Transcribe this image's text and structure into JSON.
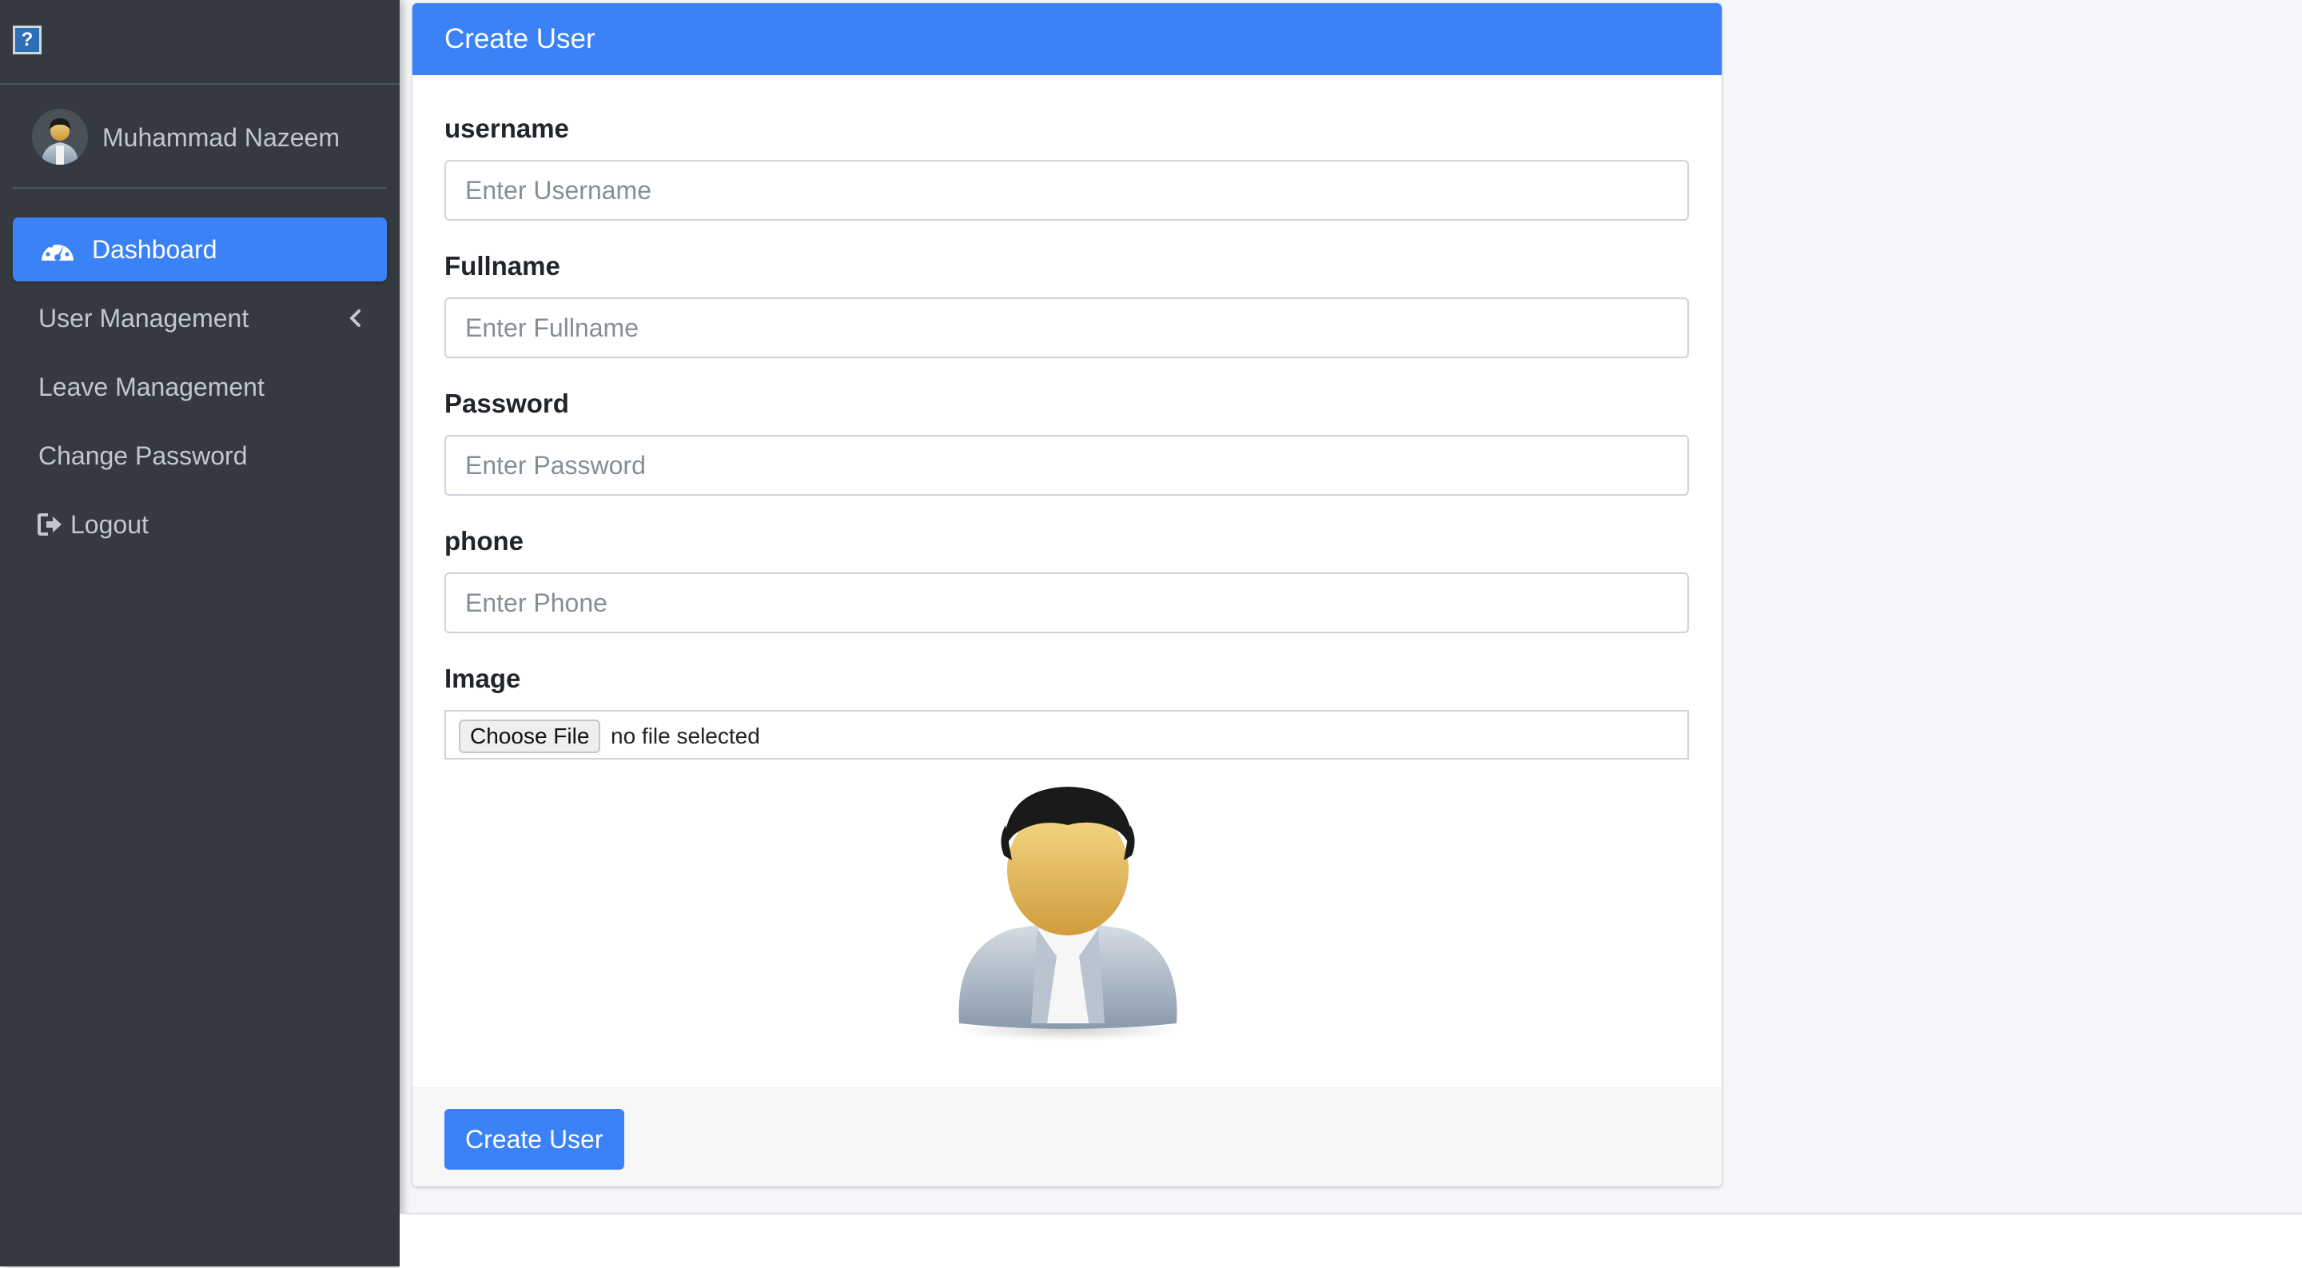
{
  "brand": {
    "icon_name": "broken-image-icon",
    "icon_glyph": "?"
  },
  "user": {
    "name": "Muhammad Nazeem",
    "avatar_icon": "user-avatar-icon"
  },
  "nav": {
    "dashboard": "Dashboard",
    "user_management": "User Management",
    "leave_management": "Leave Management",
    "change_password": "Change Password",
    "logout": "Logout"
  },
  "form": {
    "title": "Create User",
    "username": {
      "label": "username",
      "placeholder": "Enter Username",
      "value": ""
    },
    "fullname": {
      "label": "Fullname",
      "placeholder": "Enter Fullname",
      "value": ""
    },
    "password": {
      "label": "Password",
      "placeholder": "Enter Password",
      "value": ""
    },
    "phone": {
      "label": "phone",
      "placeholder": "Enter Phone",
      "value": ""
    },
    "image": {
      "label": "Image",
      "button": "Choose File",
      "status": "no file selected"
    },
    "submit": "Create User"
  },
  "colors": {
    "sidebar": "#343a40",
    "primary": "#3b82f6",
    "sidebar_text": "#c2c7d0",
    "background": "#f4f6f9"
  }
}
